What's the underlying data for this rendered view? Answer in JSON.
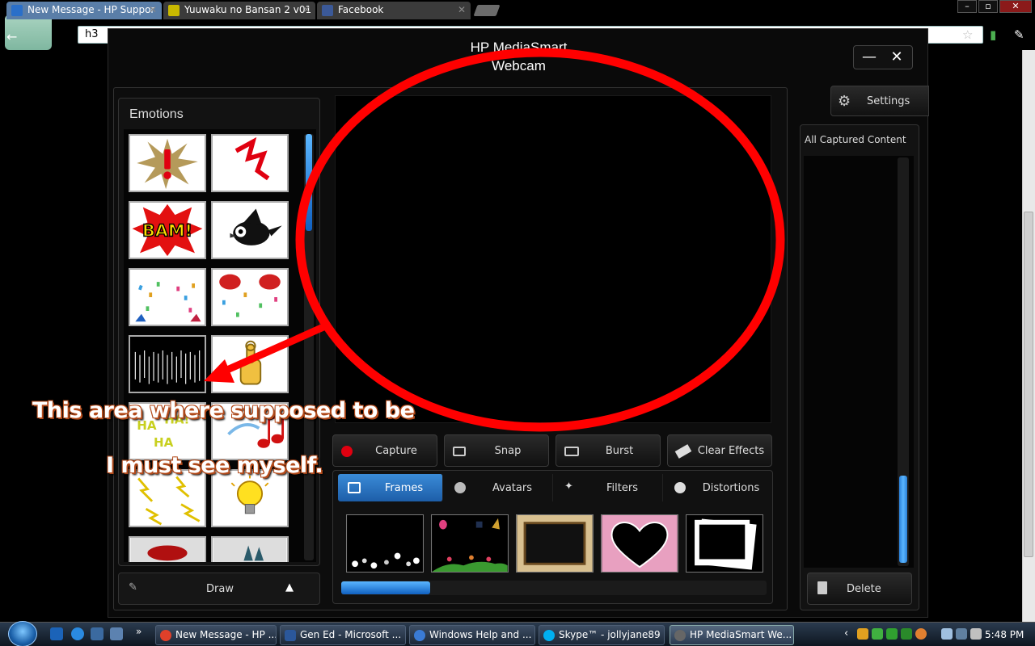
{
  "browser": {
    "tabs": [
      {
        "label": "New Message - HP Suppor",
        "color": "#5a7ea8"
      },
      {
        "label": "Yuuwaku no Bansan 2 v01",
        "color": "#3b3b3b"
      },
      {
        "label": "Facebook",
        "color": "#3b3b3b"
      }
    ],
    "omnibox_value": "h3",
    "window_controls": [
      "–",
      "▫",
      "✕"
    ]
  },
  "app": {
    "title_line1": "HP MediaSmart",
    "title_line2": "Webcam",
    "minimize_label": "—",
    "close_label": "✕",
    "emotions": {
      "title": "Emotions",
      "tiles": [
        "exclamation-burst",
        "red-zigzag",
        "bam",
        "black-bird",
        "confetti",
        "red-lips-confetti",
        "spiky-lines",
        "thumbs-up",
        "ha-ha-ha",
        "music-note",
        "lightning-bolts",
        "light-bulb",
        "red-mouth",
        "teeth"
      ]
    },
    "draw_label": "Draw",
    "actions": [
      {
        "label": "Capture",
        "icon": "record-icon"
      },
      {
        "label": "Snap",
        "icon": "camera-icon"
      },
      {
        "label": "Burst",
        "icon": "burst-icon"
      },
      {
        "label": "Clear Effects",
        "icon": "eraser-icon"
      }
    ],
    "effect_tabs": [
      {
        "label": "Frames",
        "icon": "frame-icon",
        "active": true
      },
      {
        "label": "Avatars",
        "icon": "avatar-icon",
        "active": false
      },
      {
        "label": "Filters",
        "icon": "wand-icon",
        "active": false
      },
      {
        "label": "Distortions",
        "icon": "face-icon",
        "active": false
      }
    ],
    "frames": [
      "bubbles-frame",
      "party-frame",
      "wood-frame",
      "heart-frame",
      "polaroid-frame"
    ],
    "settings_label": "Settings",
    "captured_title": "All Captured Content",
    "delete_label": "Delete"
  },
  "annotation": {
    "line1": "This area where supposed to be",
    "line2": "I must see myself.",
    "color": "#ff0000"
  },
  "taskbar": {
    "tasks": [
      {
        "label": "New Message - HP ...",
        "icon": "chrome-icon",
        "active": false
      },
      {
        "label": "Gen Ed - Microsoft ...",
        "icon": "word-icon",
        "active": false
      },
      {
        "label": "Windows Help and ...",
        "icon": "help-icon",
        "active": false
      },
      {
        "label": "Skype™ - jollyjane89",
        "icon": "skype-icon",
        "active": false
      },
      {
        "label": "HP MediaSmart We...",
        "icon": "webcam-icon",
        "active": true
      }
    ],
    "clock": "5:48 PM"
  }
}
